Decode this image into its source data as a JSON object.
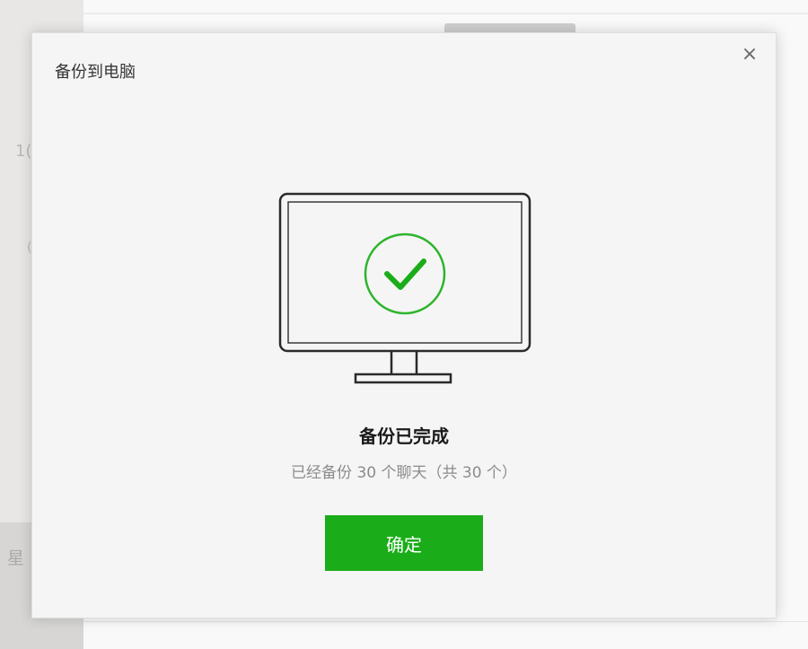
{
  "background": {
    "sidebar_text_1": "1(",
    "sidebar_text_2": "(",
    "sidebar_text_3": "星"
  },
  "dialog": {
    "title": "备份到电脑",
    "close_icon": "close-icon",
    "close_glyph": "×",
    "illustration": "monitor-check-icon",
    "status_title": "备份已完成",
    "status_detail": "已经备份 30 个聊天（共 30 个）",
    "confirm_label": "确定"
  },
  "colors": {
    "accent": "#1aad19",
    "check_circle": "#2db52c"
  }
}
